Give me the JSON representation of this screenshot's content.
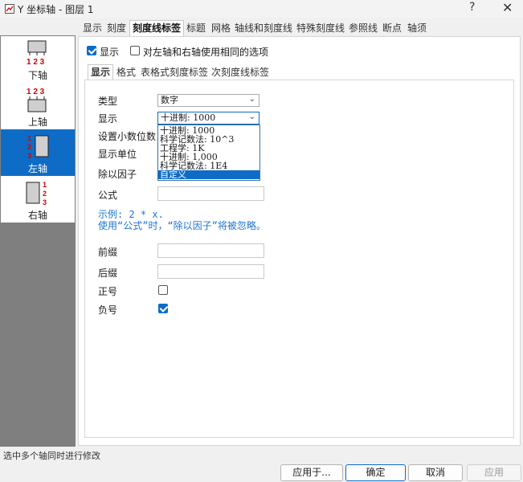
{
  "window": {
    "title": "Y 坐标轴 - 图层 1",
    "help": "?",
    "close": "✕"
  },
  "axes": [
    {
      "icon": "bottom-axis-icon",
      "ticks": "123",
      "label": "下轴"
    },
    {
      "icon": "top-axis-icon",
      "ticks": "123",
      "label": "上轴"
    },
    {
      "icon": "left-axis-icon",
      "ticks": "123",
      "label": "左轴",
      "selected": true
    },
    {
      "icon": "right-axis-icon",
      "ticks": "123",
      "label": "右轴"
    }
  ],
  "tabs": [
    "显示",
    "刻度",
    "刻度线标签",
    "标题",
    "网格",
    "轴线和刻度线",
    "特殊刻度线",
    "参照线",
    "断点",
    "轴须"
  ],
  "active_tab": "刻度线标签",
  "show_checkbox": {
    "label": "显示",
    "checked": true
  },
  "same_options_checkbox": {
    "label": "对左轴和右轴使用相同的选项",
    "checked": false
  },
  "subtabs": [
    "显示",
    "格式",
    "表格式刻度标签",
    "次刻度线标签"
  ],
  "active_subtab": "显示",
  "form": {
    "type_label": "类型",
    "type_value": "数字",
    "display_label": "显示",
    "display_value": "十进制: 1000",
    "decimals_label": "设置小数位数",
    "unit_label": "显示单位",
    "divide_label": "除以因子",
    "formula_label": "公式",
    "formula_value": "",
    "prefix_label": "前缀",
    "prefix_value": "",
    "suffix_label": "后缀",
    "suffix_value": "",
    "plus_label": "正号",
    "plus_checked": false,
    "minus_label": "负号",
    "minus_checked": true
  },
  "dropdown_options": [
    "十进制: 1000",
    "科学记数法: 10^3",
    "工程学: 1K",
    "十进制: 1,000",
    "科学记数法: 1E4",
    "自定义"
  ],
  "dropdown_selected_index": 5,
  "hint": {
    "line1": "示例: 2 * x.",
    "line2": "使用“公式”时，“除以因子”将被忽略。"
  },
  "status": "选中多个轴同时进行修改",
  "buttons": {
    "apply_to": "应用于...",
    "ok": "确定",
    "cancel": "取消",
    "apply": "应用"
  },
  "colors": {
    "accent": "#0e6cc7",
    "hint": "#1e73d6",
    "tick_red": "#d40000"
  }
}
